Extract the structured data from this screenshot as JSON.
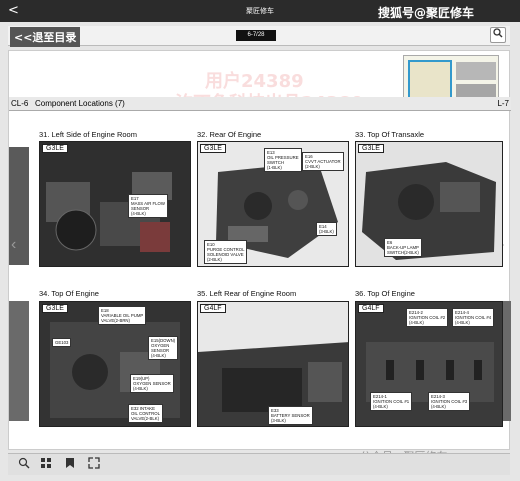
{
  "topbar": {
    "back_glyph": "<",
    "title": "聚匠修车"
  },
  "brand": "搜狐号@聚匠修车",
  "toolbar": {
    "exit_label": "<<退至目录",
    "page_indicator": "6-7/28",
    "search_icon": "search-icon"
  },
  "watermarks": [
    "用户24389",
    "汐丁鱼科技出品24389"
  ],
  "doc_header": {
    "left_code": "CL-6",
    "title": "Component Locations (7)",
    "right_code": "L-7"
  },
  "sections": [
    {
      "title": "31. Left Side of Engine Room",
      "model": "G3LE",
      "labels": [
        "E17\nMASS AIR FLOW\nSENSOR\n(4-BLK)"
      ]
    },
    {
      "title": "32. Rear Of Engine",
      "model": "G3LE",
      "labels": [
        "E13\nOIL PRESSURE\nSWITCH\n(1-BLK)",
        "E16\nCVVT ACTUATOR\n(2-BLK)",
        "E14\n(3-BLK)",
        "E10\nPURGE CONTROL\nSOLENOID VALVE\n(2-BLK)"
      ]
    },
    {
      "title": "33. Top Of Transaxle",
      "model": "G3LE",
      "labels": [
        "E6\nBACK-UP LAMP\nSWITCH(2-BLK)"
      ]
    },
    {
      "title": "34. Top Of Engine",
      "model": "G3LE",
      "labels": [
        "E18\nVARIABLE OIL PUMP\nVALVE(2-BRN)",
        "GE103",
        "E15(DOWN)\nOXYGEN\nSENSOR\n(4-BLK)",
        "E19(UP)\nOXYGEN SENSOR\n(4-BLK)",
        "E32 INTAKE\nOIL CONTROL\nVALVE(2-BLK)"
      ]
    },
    {
      "title": "35. Left Rear of Engine Room",
      "model": "G4LF",
      "labels": [
        "E33\nBATTERY SENSOR\n(3-BLK)"
      ]
    },
    {
      "title": "36. Top Of Engine",
      "model": "G4LF",
      "labels": [
        "E214-2\nIGNITION COIL #2\n(4-BLK)",
        "E214-4\nIGNITION COIL #4\n(4-BLK)",
        "E214-1\nIGNITION COIL #1\n(4-BLK)",
        "E214-3\nIGNITION COIL #3\n(4-BLK)"
      ]
    }
  ],
  "bottombar": {
    "zoom_icon": "zoom-icon",
    "grid_icon": "grid-icon",
    "bookmark_icon": "bookmark-icon",
    "fullscreen_icon": "fullscreen-icon"
  },
  "footer_watermark": "公众号 · 聚匠修车"
}
